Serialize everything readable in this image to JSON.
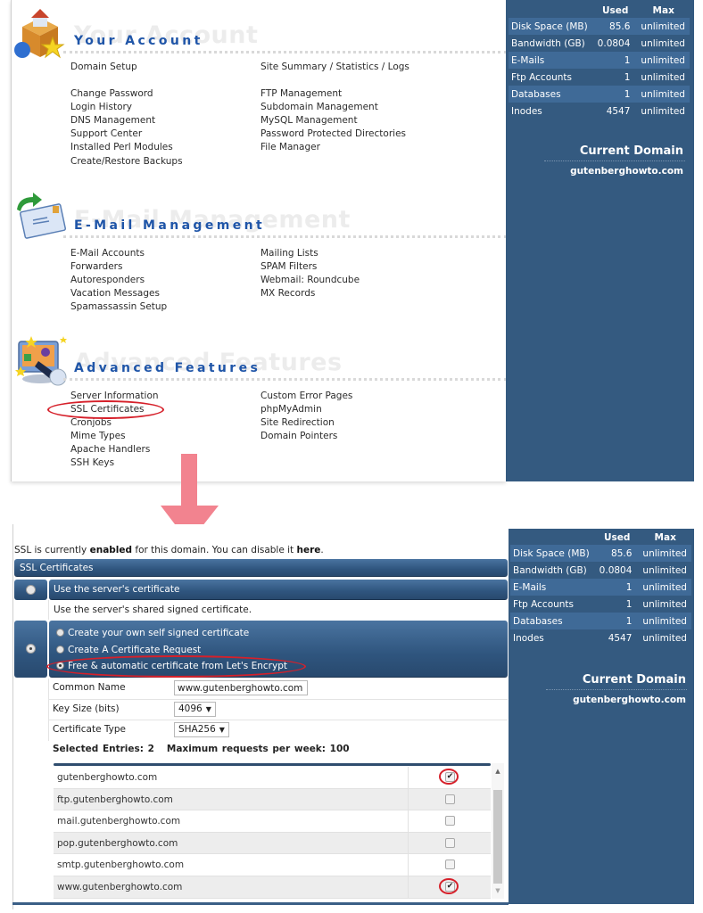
{
  "top_panel": {
    "sections": [
      {
        "title": "Your Account",
        "icon": "account-box-icon",
        "left_links": [
          "Domain Setup",
          "",
          "Change Password",
          "Login History",
          "DNS Management",
          "Support Center",
          "Installed Perl Modules",
          "Create/Restore Backups"
        ],
        "right_links": [
          "Site Summary / Statistics / Logs",
          "",
          "FTP Management",
          "Subdomain Management",
          "MySQL Management",
          "Password Protected Directories",
          "File Manager"
        ]
      },
      {
        "title": "E-Mail Management",
        "icon": "email-envelope-icon",
        "left_links": [
          "E-Mail Accounts",
          "Forwarders",
          "Autoresponders",
          "Vacation Messages",
          "Spamassassin Setup"
        ],
        "right_links": [
          "Mailing Lists",
          "SPAM Filters",
          "Webmail: Roundcube",
          "MX Records"
        ]
      },
      {
        "title": "Advanced Features",
        "icon": "advanced-features-icon",
        "left_links": [
          "Server Information",
          "SSL Certificates",
          "Cronjobs",
          "Mime Types",
          "Apache Handlers",
          "SSH Keys"
        ],
        "right_links": [
          "Custom Error Pages",
          "phpMyAdmin",
          "Site Redirection",
          "Domain Pointers"
        ]
      }
    ],
    "highlighted_link": "SSL Certificates"
  },
  "usage": {
    "headers": [
      "",
      "Used",
      "Max"
    ],
    "rows": [
      {
        "label": "Disk Space (MB)",
        "used": "85.6",
        "max": "unlimited"
      },
      {
        "label": "Bandwidth (GB)",
        "used": "0.0804",
        "max": "unlimited"
      },
      {
        "label": "E-Mails",
        "used": "1",
        "max": "unlimited"
      },
      {
        "label": "Ftp Accounts",
        "used": "1",
        "max": "unlimited"
      },
      {
        "label": "Databases",
        "used": "1",
        "max": "unlimited"
      },
      {
        "label": "Inodes",
        "used": "4547",
        "max": "unlimited"
      }
    ],
    "current_domain_label": "Current Domain",
    "current_domain": "gutenberghowto.com"
  },
  "ssl": {
    "status_prefix": "SSL is currently ",
    "status_state": "enabled",
    "status_middle": " for this domain. You can disable it ",
    "status_link": "here",
    "status_suffix": ".",
    "panel_title": "SSL Certificates",
    "server_cert_option": "Use the server's certificate",
    "server_cert_desc": "Use the server's shared signed certificate.",
    "options": [
      {
        "label": "Create your own self signed certificate",
        "selected": false
      },
      {
        "label": "Create A Certificate Request",
        "selected": false
      },
      {
        "label": "Free & automatic certificate from Let's Encrypt",
        "selected": true
      }
    ],
    "form": {
      "common_name_label": "Common Name",
      "common_name_value": "www.gutenberghowto.com",
      "key_size_label": "Key Size (bits)",
      "key_size_value": "4096",
      "cert_type_label": "Certificate Type",
      "cert_type_value": "SHA256"
    },
    "selected_entries_label": "Selected Entries: 2",
    "max_requests_label": "Maximum requests per week: 100",
    "domains": [
      {
        "name": "gutenberghowto.com",
        "checked": true
      },
      {
        "name": "ftp.gutenberghowto.com",
        "checked": false
      },
      {
        "name": "mail.gutenberghowto.com",
        "checked": false
      },
      {
        "name": "pop.gutenberghowto.com",
        "checked": false
      },
      {
        "name": "smtp.gutenberghowto.com",
        "checked": false
      },
      {
        "name": "www.gutenberghowto.com",
        "checked": true
      }
    ]
  },
  "colors": {
    "sidebar": "#345a80",
    "section_title": "#1f55a8",
    "highlight": "#d6202a",
    "arrow": "#f2838f"
  }
}
